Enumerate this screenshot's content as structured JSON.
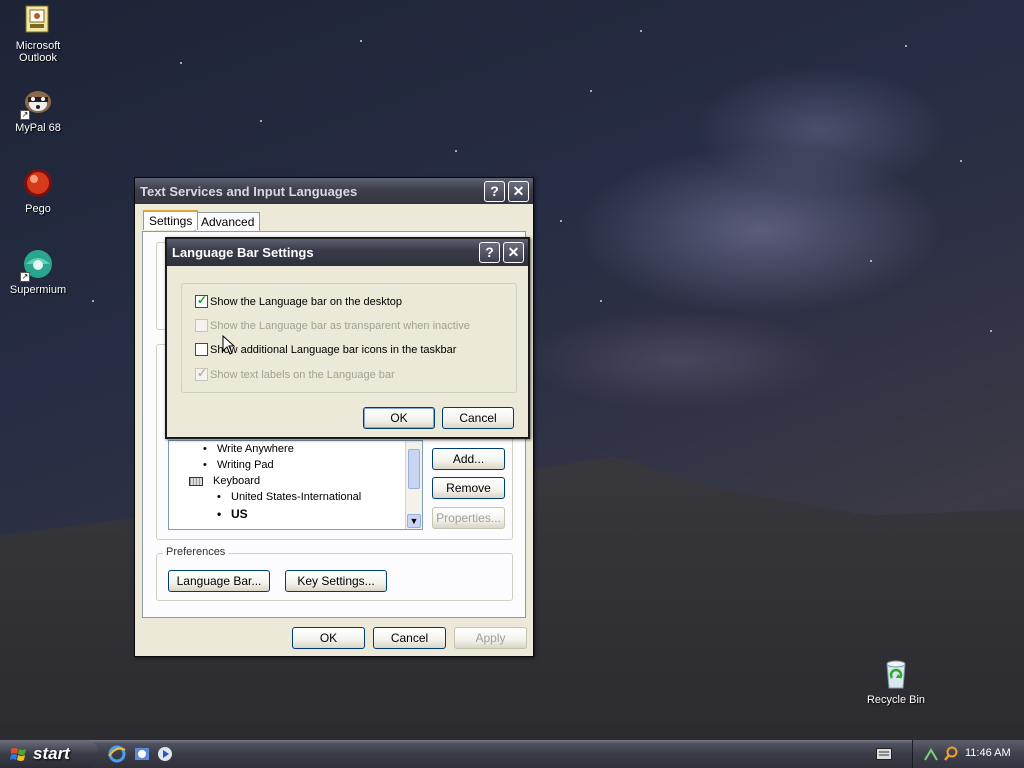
{
  "desktop": {
    "icons": [
      {
        "label": "Microsoft Outlook",
        "icon": "outlook-icon"
      },
      {
        "label": "MyPal 68",
        "icon": "mypal-icon"
      },
      {
        "label": "Pego",
        "icon": "pego-icon"
      },
      {
        "label": "Supermium",
        "icon": "supermium-icon"
      },
      {
        "label": "Recycle Bin",
        "icon": "recycle-bin-icon"
      }
    ]
  },
  "text_services": {
    "title": "Text Services and Input Languages",
    "help_glyph": "?",
    "close_glyph": "✕",
    "tabs": [
      "Settings",
      "Advanced"
    ],
    "services_list": [
      {
        "text": "Write Anywhere",
        "level": 2
      },
      {
        "text": "Writing Pad",
        "level": 2
      },
      {
        "text": "Keyboard",
        "level": 1,
        "icon": "keyboard-icon"
      },
      {
        "text": "United States-International",
        "level": 2
      },
      {
        "text": "US",
        "level": 2,
        "bold": true
      }
    ],
    "buttons": {
      "add": "Add...",
      "remove": "Remove",
      "properties": "Properties..."
    },
    "preferences": {
      "label": "Preferences",
      "language_bar_button": "Language Bar...",
      "key_settings_button": "Key Settings..."
    },
    "footer": {
      "ok": "OK",
      "cancel": "Cancel",
      "apply": "Apply"
    }
  },
  "language_bar_settings": {
    "title": "Language Bar Settings",
    "help_glyph": "?",
    "close_glyph": "✕",
    "options": [
      {
        "label": "Show the Language bar on the desktop",
        "checked": true,
        "enabled": true
      },
      {
        "label": "Show the Language bar as transparent when inactive",
        "checked": false,
        "enabled": false
      },
      {
        "label": "Show additional Language bar icons in the taskbar",
        "checked": false,
        "enabled": true
      },
      {
        "label": "Show text labels on the Language bar",
        "checked": true,
        "enabled": false
      }
    ],
    "ok": "OK",
    "cancel": "Cancel"
  },
  "taskbar": {
    "start_label": "start",
    "clock": "11:46 AM"
  },
  "colors": {
    "title_active": "#3a3c4b",
    "dialog_face": "#ece9d8",
    "button_border": "#003c74",
    "check_green": "#21a121"
  }
}
